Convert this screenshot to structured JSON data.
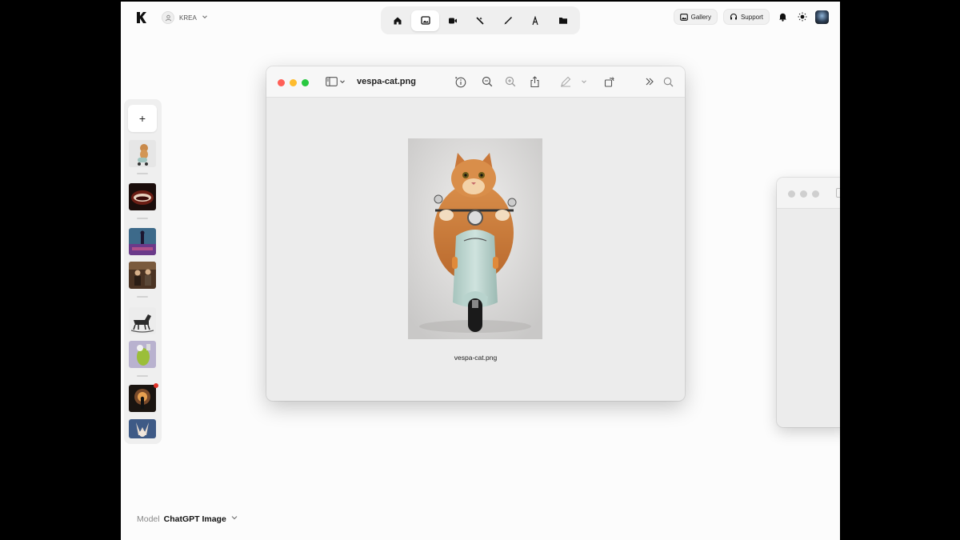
{
  "workspace": {
    "name": "KREA"
  },
  "toolbar": {
    "tools": [
      {
        "name": "home",
        "icon": "home-icon"
      },
      {
        "name": "image",
        "icon": "image-icon",
        "active": true
      },
      {
        "name": "video",
        "icon": "video-camera-icon"
      },
      {
        "name": "enhance",
        "icon": "magic-wand-icon"
      },
      {
        "name": "edit",
        "icon": "brush-icon"
      },
      {
        "name": "train",
        "icon": "text-fonts-icon"
      },
      {
        "name": "assets",
        "icon": "folder-icon"
      }
    ]
  },
  "header": {
    "gallery_label": "Gallery",
    "support_label": "Support"
  },
  "sidebar": {
    "add_label": "+",
    "thumbnails": [
      {
        "subject": "cat on scooter"
      },
      {
        "subject": "lit mouth"
      },
      {
        "subject": "figure in purple landscape"
      },
      {
        "subject": "people in room"
      },
      {
        "subject": "rocking horse"
      },
      {
        "subject": "green figure"
      },
      {
        "subject": "figure in glowing tunnel",
        "badge": true
      },
      {
        "subject": "creature with ears"
      }
    ]
  },
  "preview": {
    "filename": "vespa-cat.png",
    "caption": "vespa-cat.png",
    "colors": {
      "close": "#ff5f57",
      "minimize": "#febc2e",
      "zoom": "#28c840"
    }
  },
  "model": {
    "label": "Model",
    "value": "ChatGPT Image"
  }
}
